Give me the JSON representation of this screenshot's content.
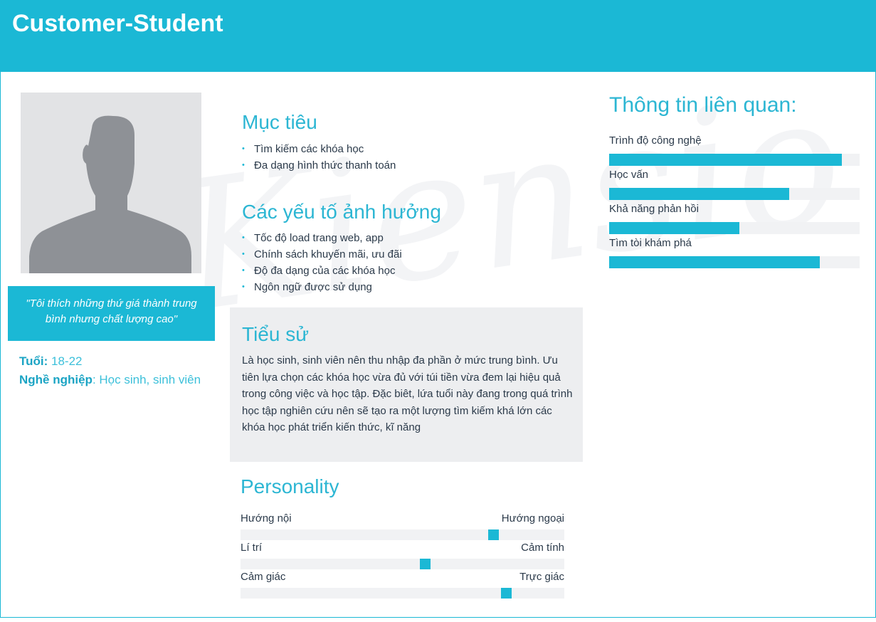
{
  "header": {
    "title": "Customer-Student"
  },
  "watermark": "Kiensio",
  "quote": "\"Tôi thích những thứ giá thành trung bình nhưng chất lượng cao\"",
  "info": {
    "age_label": "Tuổi:",
    "age": "18-22",
    "job_label": "Nghề nghiệp",
    "job": ": Học sinh, sinh viên"
  },
  "goals": {
    "title": "Mục tiêu",
    "items": [
      "Tìm kiếm các khóa học",
      "Đa dạng hình thức thanh toán"
    ]
  },
  "factors": {
    "title": "Các yếu tố ảnh hưởng",
    "items": [
      "Tốc độ load trang web, app",
      "Chính sách khuyến mãi, ưu đãi",
      "Độ đa dạng của các khóa học",
      "Ngôn ngữ được sử dụng"
    ]
  },
  "bio": {
    "title": "Tiểu sử",
    "text": "Là học sinh, sinh viên nên thu nhập đa phần ở mức trung bình. Ưu tiên lựa chọn các khóa học vừa đủ với túi tiền vừa đem lại hiệu quả trong công việc và học tập. Đặc biêt, lứa tuổi này đang trong quá trình học tập nghiên cứu nên sẽ tạo ra một lượng tìm kiếm khá lớn các khóa học phát triển kiến thức, kĩ năng"
  },
  "personality": {
    "title": "Personality",
    "traits": [
      {
        "left": "Hướng nội",
        "right": "Hướng ngoại",
        "value": 0.78
      },
      {
        "left": "Lí trí",
        "right": "Cảm tính",
        "value": 0.57
      },
      {
        "left": "Cảm giác",
        "right": "Trực giác",
        "value": 0.82
      }
    ]
  },
  "related": {
    "title": "Thông tin liên quan:",
    "bars": [
      {
        "label": "Trình độ công nghệ",
        "value": 0.93
      },
      {
        "label": "Học vấn",
        "value": 0.72
      },
      {
        "label": "Khả năng phản hồi",
        "value": 0.52
      },
      {
        "label": "Tìm tòi khám phá",
        "value": 0.84
      }
    ]
  },
  "colors": {
    "accent": "#1bb8d5"
  }
}
